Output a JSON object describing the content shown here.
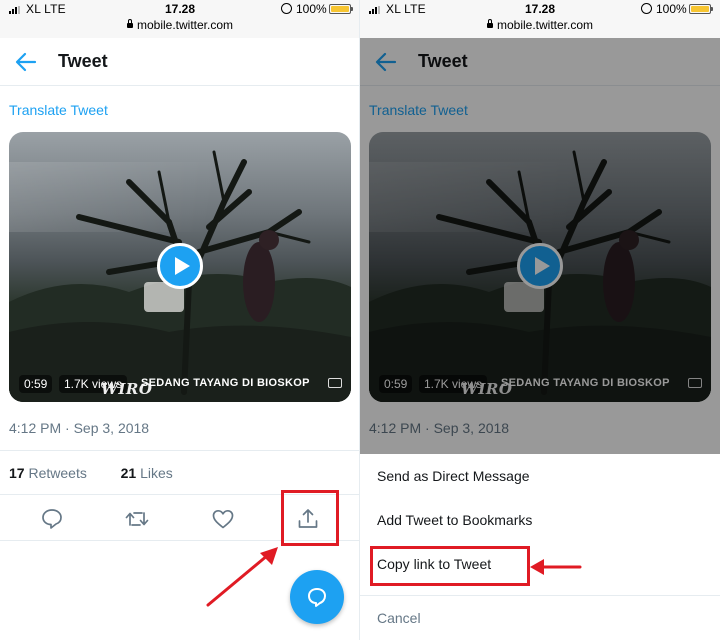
{
  "status_bar": {
    "carrier": "XL  LTE",
    "time": "17.28",
    "url": "mobile.twitter.com",
    "battery": "100%"
  },
  "header": {
    "title": "Tweet"
  },
  "tweet": {
    "translate_label": "Translate Tweet",
    "video": {
      "duration": "0:59",
      "views": "1.7K views",
      "overlay_title": "WIRO",
      "caption": "SEDANG TAYANG DI BIOSKOP"
    },
    "timestamp": "4:12 PM · Sep 3, 2018",
    "retweets_count": "17",
    "retweets_label": "Retweets",
    "likes_count": "21",
    "likes_label": "Likes"
  },
  "share_sheet": {
    "items": [
      "Send as Direct Message",
      "Add Tweet to Bookmarks",
      "Copy link to Tweet"
    ],
    "cancel": "Cancel"
  },
  "colors": {
    "accent": "#1da1f2",
    "annotation": "#e01b24",
    "battery": "#f7c531",
    "secondary_text": "#657786"
  },
  "icons": [
    "back-arrow-icon",
    "play-icon",
    "reply-icon",
    "retweet-icon",
    "like-icon",
    "share-icon",
    "compose-icon",
    "lock-icon",
    "signal-icon",
    "battery-icon"
  ]
}
